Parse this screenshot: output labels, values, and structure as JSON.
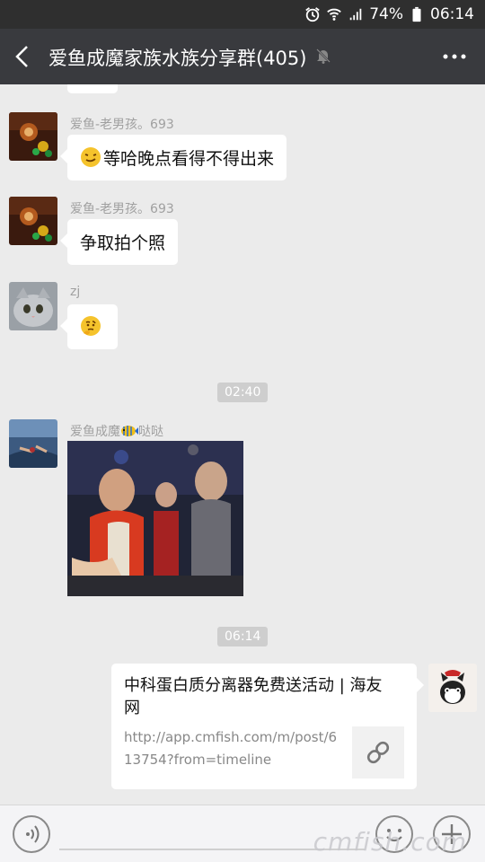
{
  "status_bar": {
    "battery": "74%",
    "time": "06:14"
  },
  "header": {
    "title": "爱鱼成魔家族水族分享群(405)"
  },
  "messages": [
    {
      "sender": "爱鱼-老男孩。693",
      "text": "等哈晚点看得不得出来",
      "emoji": "smirk-emoji"
    },
    {
      "sender": "爱鱼-老男孩。693",
      "text": "争取拍个照"
    },
    {
      "sender": "zj",
      "emoji": "thinking-emoji"
    },
    {
      "time": "02:40"
    },
    {
      "sender": "爱鱼成魔",
      "sender_suffix": "哒哒",
      "image": "crowd-photo"
    },
    {
      "time": "06:14"
    }
  ],
  "link_card": {
    "title": "中科蛋白质分离器免费送活动 | 海友网",
    "url": "http://app.cmfish.com/m/post/613754?from=timeline",
    "icon": "link-icon"
  },
  "watermark": "cmfish.com",
  "colors": {
    "status_bar": "#2f2f2f",
    "title_bar": "#393a3e",
    "chat_bg": "#ebebeb",
    "time_badge": "#cecece"
  }
}
